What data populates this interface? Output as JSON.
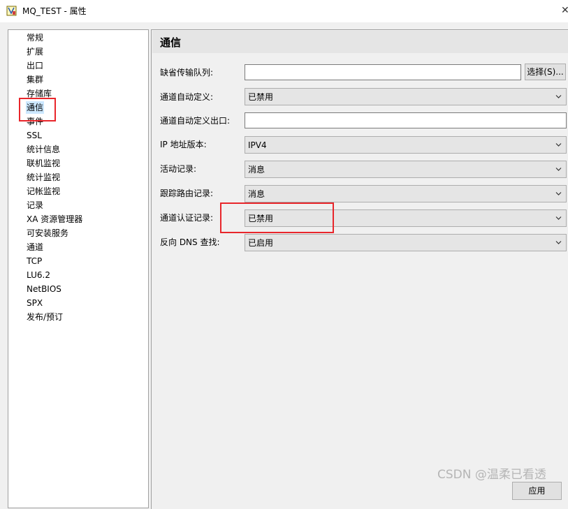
{
  "window": {
    "title": "MQ_TEST - 属性",
    "close_glyph": "✕"
  },
  "nav": {
    "items": [
      "常规",
      "扩展",
      "出口",
      "集群",
      "存储库",
      "通信",
      "事件",
      "SSL",
      "统计信息",
      "联机监视",
      "统计监视",
      "记帐监视",
      "记录",
      "XA 资源管理器",
      "可安装服务",
      "通道",
      "TCP",
      "LU6.2",
      "NetBIOS",
      "SPX",
      "发布/预订"
    ],
    "selected": "通信"
  },
  "section": {
    "title": "通信"
  },
  "form": {
    "dead_letter_queue": {
      "label": "缺省传输队列:",
      "value": ""
    },
    "select_button": "选择(S)...",
    "channel_auto_def": {
      "label": "通道自动定义:",
      "value": "已禁用"
    },
    "channel_auto_def_exit": {
      "label": "通道自动定义出口:",
      "value": ""
    },
    "ip_version": {
      "label": "IP 地址版本:",
      "value": "IPV4"
    },
    "activity_recording": {
      "label": "活动记录:",
      "value": "消息"
    },
    "trace_route_recording": {
      "label": "跟踪路由记录:",
      "value": "消息"
    },
    "channel_auth_recording": {
      "label": "通道认证记录:",
      "value": "已禁用"
    },
    "reverse_dns": {
      "label": "反向 DNS 查找:",
      "value": "已启用"
    }
  },
  "footer": {
    "apply_button": "应用"
  },
  "watermark": "CSDN @温柔已看透",
  "colors": {
    "highlight_box": "#e8262b",
    "selection": "#cce8ff",
    "header_bg": "#e5e5e5",
    "window_bg": "#f0f0f0"
  }
}
